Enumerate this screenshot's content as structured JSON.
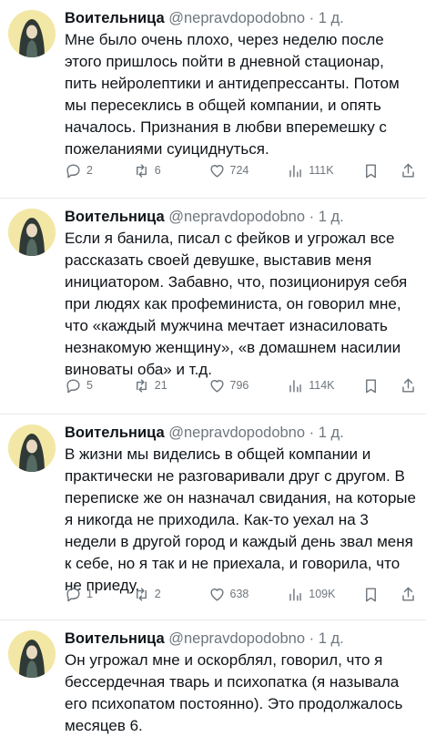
{
  "tweets": [
    {
      "name": "Воительница",
      "handle": "@nepravdopodobno",
      "dot": "·",
      "time": "1 д.",
      "text": "Мне было очень плохо, через неделю после этого пришлось пойти в дневной стационар, пить нейролептики и антидепрессанты. Потом мы пересеклись в общей компании, и опять началось. Признания в любви вперемешку с пожеланиями суициднуться.",
      "replies": "2",
      "retweets": "6",
      "likes": "724",
      "views": "111K"
    },
    {
      "name": "Воительница",
      "handle": "@nepravdopodobno",
      "dot": "·",
      "time": "1 д.",
      "text": "Если я банила, писал с фейков и угрожал все рассказать своей девушке, выставив меня инициатором. Забавно, что, позиционируя себя при людях как профеминиста, он говорил мне, что «каждый мужчина мечтает изнасиловать незнакомую женщину», «в домашнем насилии виноваты оба» и т.д.",
      "replies": "5",
      "retweets": "21",
      "likes": "796",
      "views": "114K"
    },
    {
      "name": "Воительница",
      "handle": "@nepravdopodobno",
      "dot": "·",
      "time": "1 д.",
      "text": "В жизни мы виделись в общей компании и практически не разговаривали друг с другом. В переписке же он назначал свидания, на которые я никогда не приходила. Как-то уехал на 3 недели в другой город и каждый день звал меня к себе, но я так и не приехала, и говорила, что не приеду.",
      "replies": "1",
      "retweets": "2",
      "likes": "638",
      "views": "109K"
    },
    {
      "name": "Воительница",
      "handle": "@nepravdopodobno",
      "dot": "·",
      "time": "1 д.",
      "text": "Он угрожал мне и оскорблял, говорил, что я бессердечная тварь и психопатка (я называла его психопатом постоянно). Это продолжалось месяцев 6."
    }
  ],
  "icons": {
    "reply": "reply-icon",
    "retweet": "retweet-icon",
    "like": "heart-icon",
    "views": "views-icon",
    "bookmark": "bookmark-icon",
    "share": "share-icon"
  },
  "colors": {
    "text": "#0f1419",
    "muted": "#6e767d",
    "avatar_bg": "#f3e7a6"
  }
}
